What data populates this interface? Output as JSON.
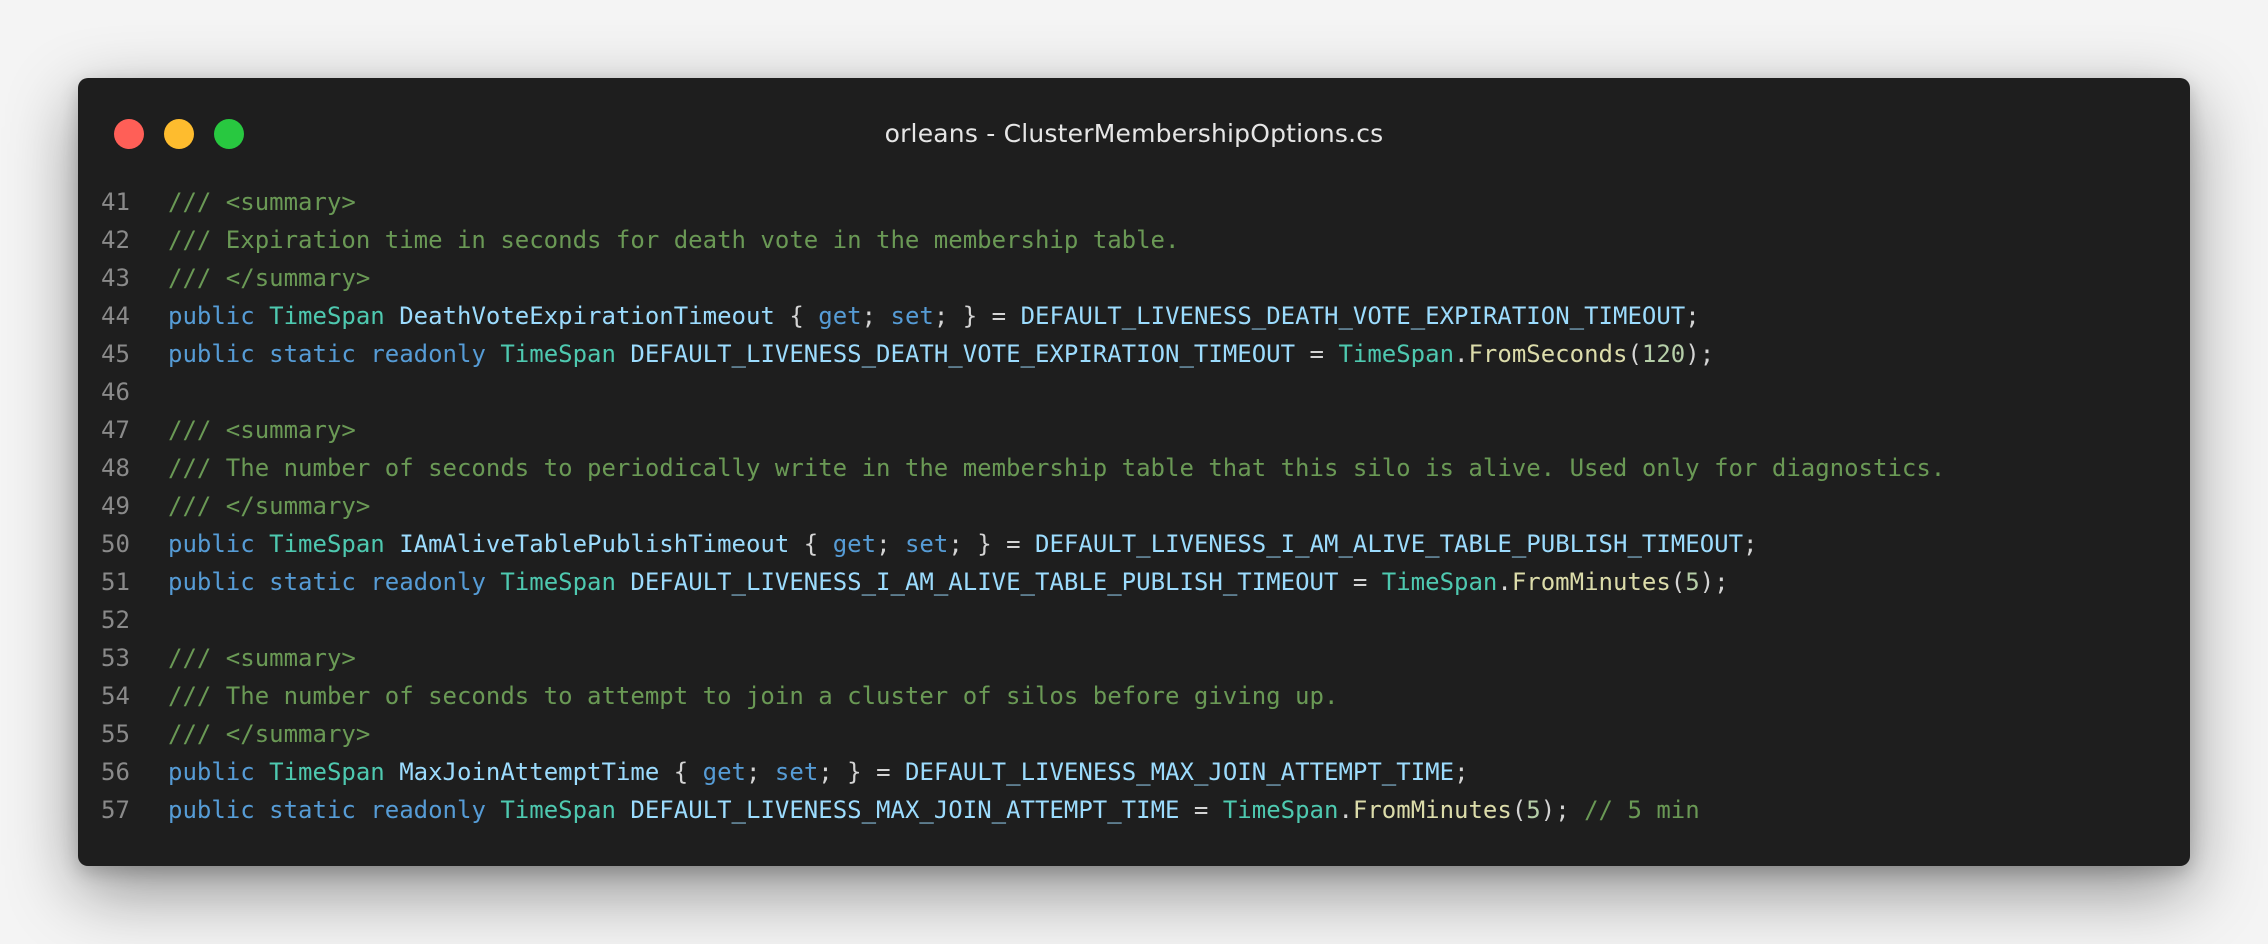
{
  "window": {
    "title": "orleans - ClusterMembershipOptions.cs",
    "controls": [
      {
        "name": "close",
        "color": "#ff5f57"
      },
      {
        "name": "minimize",
        "color": "#febc2e"
      },
      {
        "name": "zoom",
        "color": "#28c840"
      }
    ]
  },
  "code": {
    "lines": [
      {
        "number": "41",
        "tokens": [
          {
            "t": "/// <summary>",
            "k": "comment"
          }
        ]
      },
      {
        "number": "42",
        "tokens": [
          {
            "t": "/// Expiration time in seconds for death vote in the membership table.",
            "k": "comment"
          }
        ]
      },
      {
        "number": "43",
        "tokens": [
          {
            "t": "/// </summary>",
            "k": "comment"
          }
        ]
      },
      {
        "number": "44",
        "tokens": [
          {
            "t": "public",
            "k": "keyword"
          },
          {
            "t": " ",
            "k": "punct"
          },
          {
            "t": "TimeSpan",
            "k": "type"
          },
          {
            "t": " ",
            "k": "punct"
          },
          {
            "t": "DeathVoteExpirationTimeout",
            "k": "ident"
          },
          {
            "t": " { ",
            "k": "punct"
          },
          {
            "t": "get",
            "k": "keyword"
          },
          {
            "t": "; ",
            "k": "punct"
          },
          {
            "t": "set",
            "k": "keyword"
          },
          {
            "t": "; } = ",
            "k": "punct"
          },
          {
            "t": "DEFAULT_LIVENESS_DEATH_VOTE_EXPIRATION_TIMEOUT",
            "k": "ident"
          },
          {
            "t": ";",
            "k": "punct"
          }
        ]
      },
      {
        "number": "45",
        "tokens": [
          {
            "t": "public",
            "k": "keyword"
          },
          {
            "t": " ",
            "k": "punct"
          },
          {
            "t": "static",
            "k": "keyword"
          },
          {
            "t": " ",
            "k": "punct"
          },
          {
            "t": "readonly",
            "k": "keyword"
          },
          {
            "t": " ",
            "k": "punct"
          },
          {
            "t": "TimeSpan",
            "k": "type"
          },
          {
            "t": " ",
            "k": "punct"
          },
          {
            "t": "DEFAULT_LIVENESS_DEATH_VOTE_EXPIRATION_TIMEOUT",
            "k": "ident"
          },
          {
            "t": " = ",
            "k": "punct"
          },
          {
            "t": "TimeSpan",
            "k": "type"
          },
          {
            "t": ".",
            "k": "punct"
          },
          {
            "t": "FromSeconds",
            "k": "func"
          },
          {
            "t": "(",
            "k": "punct"
          },
          {
            "t": "120",
            "k": "number"
          },
          {
            "t": ");",
            "k": "punct"
          }
        ]
      },
      {
        "number": "46",
        "tokens": []
      },
      {
        "number": "47",
        "tokens": [
          {
            "t": "/// <summary>",
            "k": "comment"
          }
        ]
      },
      {
        "number": "48",
        "tokens": [
          {
            "t": "/// The number of seconds to periodically write in the membership table that this silo is alive. Used only for diagnostics.",
            "k": "comment"
          }
        ]
      },
      {
        "number": "49",
        "tokens": [
          {
            "t": "/// </summary>",
            "k": "comment"
          }
        ]
      },
      {
        "number": "50",
        "tokens": [
          {
            "t": "public",
            "k": "keyword"
          },
          {
            "t": " ",
            "k": "punct"
          },
          {
            "t": "TimeSpan",
            "k": "type"
          },
          {
            "t": " ",
            "k": "punct"
          },
          {
            "t": "IAmAliveTablePublishTimeout",
            "k": "ident"
          },
          {
            "t": " { ",
            "k": "punct"
          },
          {
            "t": "get",
            "k": "keyword"
          },
          {
            "t": "; ",
            "k": "punct"
          },
          {
            "t": "set",
            "k": "keyword"
          },
          {
            "t": "; } = ",
            "k": "punct"
          },
          {
            "t": "DEFAULT_LIVENESS_I_AM_ALIVE_TABLE_PUBLISH_TIMEOUT",
            "k": "ident"
          },
          {
            "t": ";",
            "k": "punct"
          }
        ]
      },
      {
        "number": "51",
        "tokens": [
          {
            "t": "public",
            "k": "keyword"
          },
          {
            "t": " ",
            "k": "punct"
          },
          {
            "t": "static",
            "k": "keyword"
          },
          {
            "t": " ",
            "k": "punct"
          },
          {
            "t": "readonly",
            "k": "keyword"
          },
          {
            "t": " ",
            "k": "punct"
          },
          {
            "t": "TimeSpan",
            "k": "type"
          },
          {
            "t": " ",
            "k": "punct"
          },
          {
            "t": "DEFAULT_LIVENESS_I_AM_ALIVE_TABLE_PUBLISH_TIMEOUT",
            "k": "ident"
          },
          {
            "t": " = ",
            "k": "punct"
          },
          {
            "t": "TimeSpan",
            "k": "type"
          },
          {
            "t": ".",
            "k": "punct"
          },
          {
            "t": "FromMinutes",
            "k": "func"
          },
          {
            "t": "(",
            "k": "punct"
          },
          {
            "t": "5",
            "k": "number"
          },
          {
            "t": ");",
            "k": "punct"
          }
        ]
      },
      {
        "number": "52",
        "tokens": []
      },
      {
        "number": "53",
        "tokens": [
          {
            "t": "/// <summary>",
            "k": "comment"
          }
        ]
      },
      {
        "number": "54",
        "tokens": [
          {
            "t": "/// The number of seconds to attempt to join a cluster of silos before giving up.",
            "k": "comment"
          }
        ]
      },
      {
        "number": "55",
        "tokens": [
          {
            "t": "/// </summary>",
            "k": "comment"
          }
        ]
      },
      {
        "number": "56",
        "tokens": [
          {
            "t": "public",
            "k": "keyword"
          },
          {
            "t": " ",
            "k": "punct"
          },
          {
            "t": "TimeSpan",
            "k": "type"
          },
          {
            "t": " ",
            "k": "punct"
          },
          {
            "t": "MaxJoinAttemptTime",
            "k": "ident"
          },
          {
            "t": " { ",
            "k": "punct"
          },
          {
            "t": "get",
            "k": "keyword"
          },
          {
            "t": "; ",
            "k": "punct"
          },
          {
            "t": "set",
            "k": "keyword"
          },
          {
            "t": "; } = ",
            "k": "punct"
          },
          {
            "t": "DEFAULT_LIVENESS_MAX_JOIN_ATTEMPT_TIME",
            "k": "ident"
          },
          {
            "t": ";",
            "k": "punct"
          }
        ]
      },
      {
        "number": "57",
        "tokens": [
          {
            "t": "public",
            "k": "keyword"
          },
          {
            "t": " ",
            "k": "punct"
          },
          {
            "t": "static",
            "k": "keyword"
          },
          {
            "t": " ",
            "k": "punct"
          },
          {
            "t": "readonly",
            "k": "keyword"
          },
          {
            "t": " ",
            "k": "punct"
          },
          {
            "t": "TimeSpan",
            "k": "type"
          },
          {
            "t": " ",
            "k": "punct"
          },
          {
            "t": "DEFAULT_LIVENESS_MAX_JOIN_ATTEMPT_TIME",
            "k": "ident"
          },
          {
            "t": " = ",
            "k": "punct"
          },
          {
            "t": "TimeSpan",
            "k": "type"
          },
          {
            "t": ".",
            "k": "punct"
          },
          {
            "t": "FromMinutes",
            "k": "func"
          },
          {
            "t": "(",
            "k": "punct"
          },
          {
            "t": "5",
            "k": "number"
          },
          {
            "t": "); ",
            "k": "punct"
          },
          {
            "t": "// 5 min",
            "k": "comment"
          }
        ]
      }
    ]
  }
}
